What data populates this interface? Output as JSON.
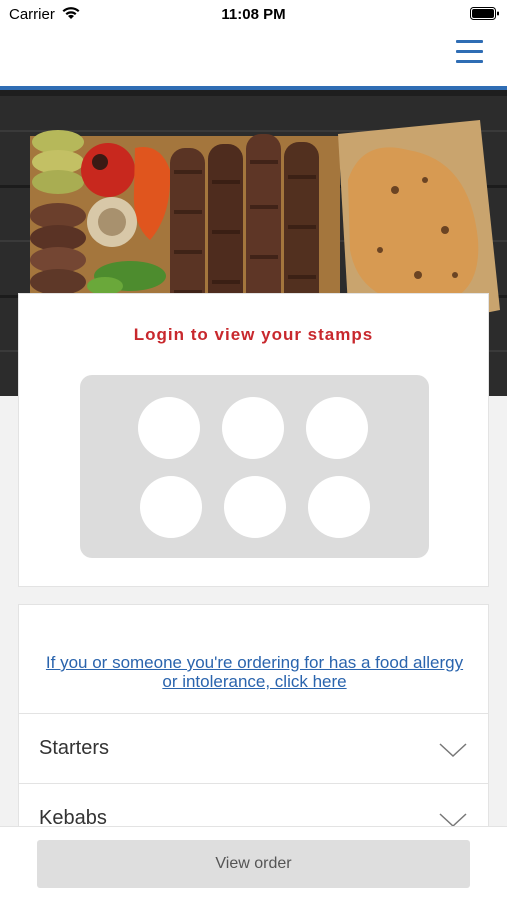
{
  "status_bar": {
    "carrier": "Carrier",
    "time": "11:08 PM"
  },
  "nav": {
    "menu_icon": "hamburger-menu-icon",
    "accent_color": "#2f6db4"
  },
  "hero": {
    "image": "grilled-kebabs-with-vegetables-and-bread"
  },
  "stamps": {
    "login_text": "Login to view your stamps",
    "count": 6,
    "login_color": "#c8282d"
  },
  "allergy": {
    "link_text": "If you or someone you're ordering for has a food allergy or intolerance, click here",
    "link_color": "#2a64ad"
  },
  "categories": [
    {
      "label": "Starters",
      "icon": "chevron-down-icon"
    },
    {
      "label": "Kebabs",
      "icon": "chevron-down-icon"
    }
  ],
  "footer": {
    "view_order_label": "View order"
  }
}
